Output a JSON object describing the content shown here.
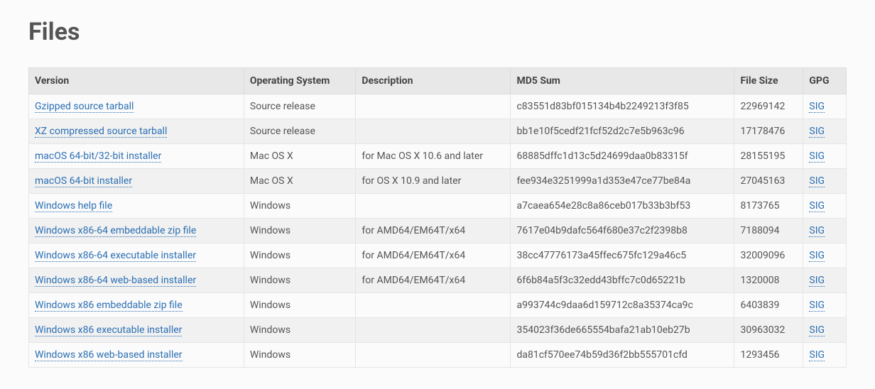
{
  "title": "Files",
  "headers": {
    "version": "Version",
    "os": "Operating System",
    "description": "Description",
    "md5": "MD5 Sum",
    "size": "File Size",
    "gpg": "GPG"
  },
  "sig_label": "SIG",
  "rows": [
    {
      "version": "Gzipped source tarball",
      "os": "Source release",
      "description": "",
      "md5": "c83551d83bf015134b4b2249213f3f85",
      "size": "22969142"
    },
    {
      "version": "XZ compressed source tarball",
      "os": "Source release",
      "description": "",
      "md5": "bb1e10f5cedf21fcf52d2c7e5b963c96",
      "size": "17178476"
    },
    {
      "version": "macOS 64-bit/32-bit installer",
      "os": "Mac OS X",
      "description": "for Mac OS X 10.6 and later",
      "md5": "68885dffc1d13c5d24699daa0b83315f",
      "size": "28155195"
    },
    {
      "version": "macOS 64-bit installer",
      "os": "Mac OS X",
      "description": "for OS X 10.9 and later",
      "md5": "fee934e3251999a1d353e47ce77be84a",
      "size": "27045163"
    },
    {
      "version": "Windows help file",
      "os": "Windows",
      "description": "",
      "md5": "a7caea654e28c8a86ceb017b33b3bf53",
      "size": "8173765"
    },
    {
      "version": "Windows x86-64 embeddable zip file",
      "os": "Windows",
      "description": "for AMD64/EM64T/x64",
      "md5": "7617e04b9dafc564f680e37c2f2398b8",
      "size": "7188094"
    },
    {
      "version": "Windows x86-64 executable installer",
      "os": "Windows",
      "description": "for AMD64/EM64T/x64",
      "md5": "38cc47776173a45ffec675fc129a46c5",
      "size": "32009096"
    },
    {
      "version": "Windows x86-64 web-based installer",
      "os": "Windows",
      "description": "for AMD64/EM64T/x64",
      "md5": "6f6b84a5f3c32edd43bffc7c0d65221b",
      "size": "1320008"
    },
    {
      "version": "Windows x86 embeddable zip file",
      "os": "Windows",
      "description": "",
      "md5": "a993744c9daa6d159712c8a35374ca9c",
      "size": "6403839"
    },
    {
      "version": "Windows x86 executable installer",
      "os": "Windows",
      "description": "",
      "md5": "354023f36de665554bafa21ab10eb27b",
      "size": "30963032"
    },
    {
      "version": "Windows x86 web-based installer",
      "os": "Windows",
      "description": "",
      "md5": "da81cf570ee74b59d36f2bb555701cfd",
      "size": "1293456"
    }
  ]
}
